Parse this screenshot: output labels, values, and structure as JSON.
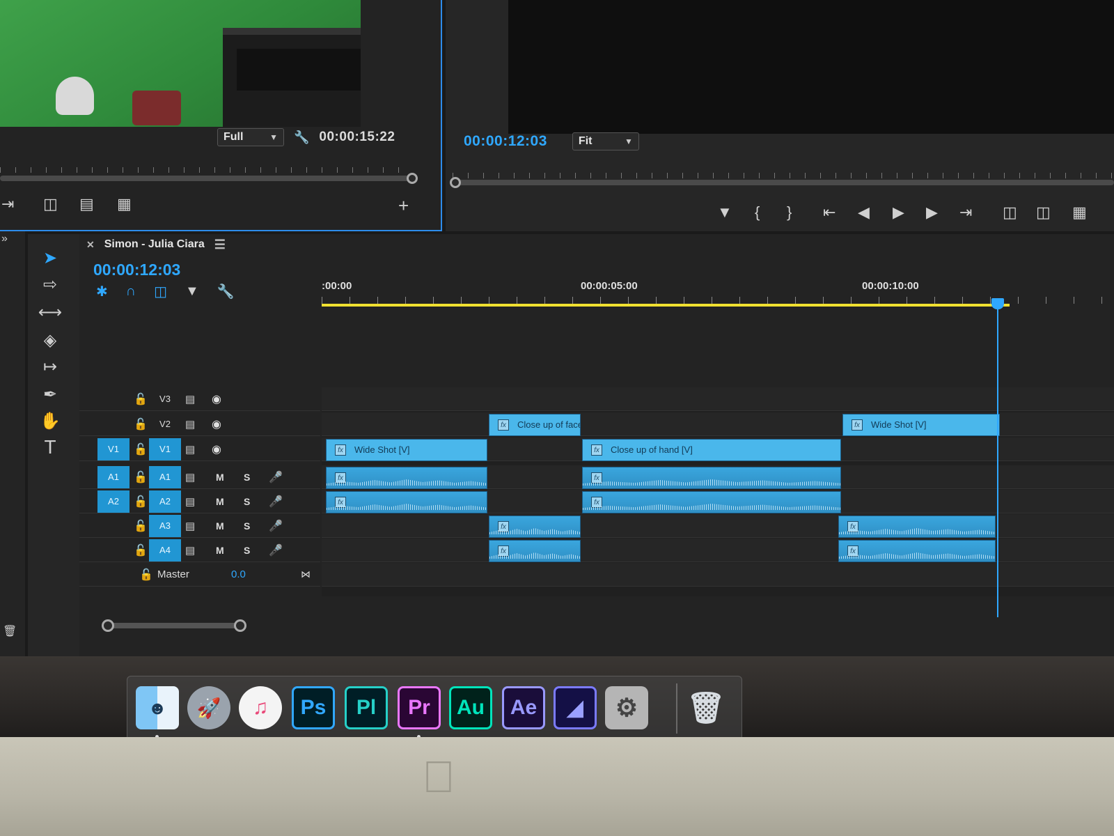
{
  "source": {
    "resolution": "Full",
    "timecode": "00:00:15:22"
  },
  "program": {
    "timecode": "00:00:12:03",
    "zoom": "Fit"
  },
  "sequence": {
    "name": "Simon - Julia Ciara",
    "timecode": "00:00:12:03",
    "ruler_labels": [
      ":00:00",
      "00:00:05:00",
      "00:00:10:00"
    ]
  },
  "tracks": {
    "v3": "V3",
    "v2": "V2",
    "v1": "V1",
    "v1_src": "V1",
    "a1": "A1",
    "a1_src": "A1",
    "a2": "A2",
    "a2_src": "A2",
    "a3": "A3",
    "a4": "A4",
    "mute": "M",
    "solo": "S",
    "master_label": "Master",
    "master_value": "0.0"
  },
  "clips": {
    "fx": "fx",
    "wide_shot_1": "Wide Shot [V]",
    "close_up_face": "Close up of face",
    "close_up_hand": "Close up of hand [V]",
    "wide_shot_2": "Wide Shot [V]"
  },
  "dock": {
    "ps": "Ps",
    "pl": "Pl",
    "pr": "Pr",
    "au": "Au",
    "ae": "Ae"
  },
  "colors": {
    "accent": "#2fa8ff",
    "clip_video": "#4ab7eb",
    "clip_audio": "#2f8fc4",
    "work_area": "#f0e030"
  },
  "icons": [
    "wrench-icon",
    "camera-icon",
    "plus-icon",
    "play-icon",
    "step-back-icon",
    "step-forward-icon",
    "go-to-in-icon",
    "go-to-out-icon",
    "mark-in-icon",
    "mark-out-icon",
    "marker-icon",
    "insert-icon",
    "overwrite-icon",
    "export-frame-icon",
    "lock-icon",
    "eye-icon",
    "mic-icon",
    "selection-tool-icon",
    "track-select-icon",
    "ripple-edit-icon",
    "razor-icon",
    "slip-icon",
    "pen-icon",
    "hand-icon",
    "type-icon",
    "snap-icon",
    "linked-selection-icon",
    "nest-icon",
    "wrench-icon",
    "apple-logo-icon"
  ]
}
